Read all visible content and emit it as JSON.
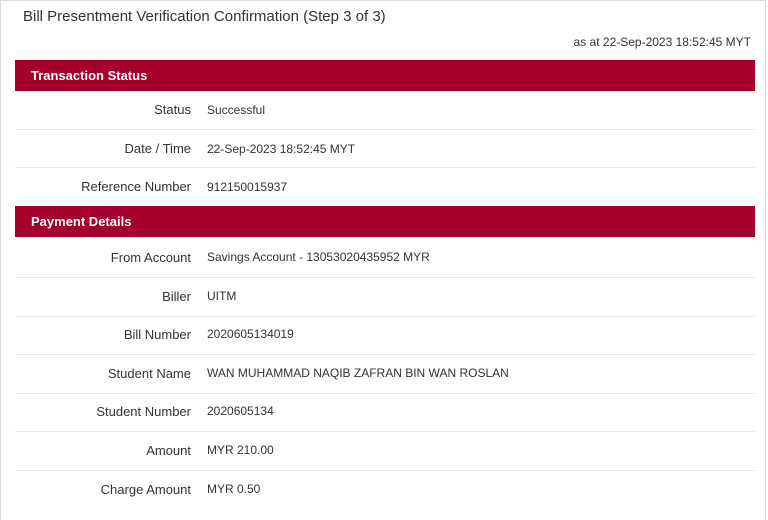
{
  "page": {
    "title": "Bill Presentment Verification Confirmation (Step 3 of 3)",
    "as_at": "as at 22-Sep-2023 18:52:45 MYT"
  },
  "transaction_status": {
    "heading": "Transaction Status",
    "rows": [
      {
        "label": "Status",
        "value": "Successful"
      },
      {
        "label": "Date / Time",
        "value": "22-Sep-2023 18:52:45 MYT"
      },
      {
        "label": "Reference Number",
        "value": "912150015937"
      }
    ]
  },
  "payment_details": {
    "heading": "Payment Details",
    "rows": [
      {
        "label": "From Account",
        "value": "Savings Account - 13053020435952 MYR"
      },
      {
        "label": "Biller",
        "value": "UITM"
      },
      {
        "label": "Bill Number",
        "value": "2020605134019"
      },
      {
        "label": "Student Name",
        "value": "WAN MUHAMMAD NAQIB ZAFRAN BIN WAN ROSLAN"
      },
      {
        "label": "Student Number",
        "value": "2020605134"
      },
      {
        "label": "Amount",
        "value": "MYR 210.00"
      },
      {
        "label": "Charge Amount",
        "value": "MYR 0.50"
      }
    ]
  },
  "colors": {
    "section_header_bg": "#a3002b",
    "section_header_text": "#ffffff"
  }
}
